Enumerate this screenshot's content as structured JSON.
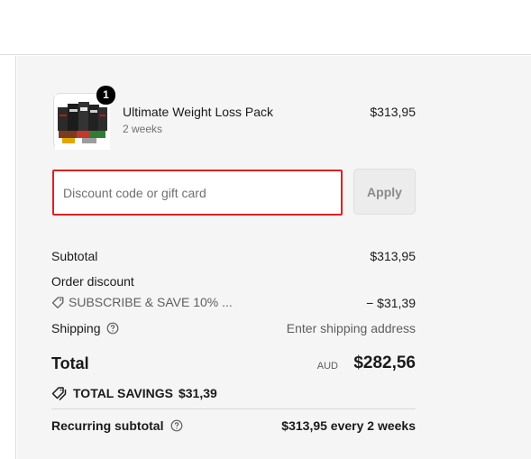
{
  "product": {
    "name": "Ultimate Weight Loss Pack",
    "variant": "2 weeks",
    "price": "$313,95",
    "quantity": "1",
    "thumbnail_icon": "product-pack-image"
  },
  "discount": {
    "placeholder": "Discount code or gift card",
    "value": "",
    "apply_label": "Apply",
    "error_border_color": "#e02020"
  },
  "summary": {
    "subtotal_label": "Subtotal",
    "subtotal_value": "$313,95",
    "order_discount_label": "Order discount",
    "discount_code": "SUBSCRIBE & SAVE 10% ...",
    "discount_code_icon": "tag-icon",
    "discount_value": "− $31,39",
    "shipping_label": "Shipping",
    "shipping_help_icon": "help-circle-icon",
    "shipping_value": "Enter shipping address",
    "total_label": "Total",
    "total_currency": "AUD",
    "total_value": "$282,56",
    "savings_icon": "savings-tags-icon",
    "savings_label": "TOTAL SAVINGS",
    "savings_value": "$31,39",
    "recurring_label": "Recurring subtotal",
    "recurring_help_icon": "help-circle-icon",
    "recurring_value": "$313,95 every 2 weeks"
  }
}
